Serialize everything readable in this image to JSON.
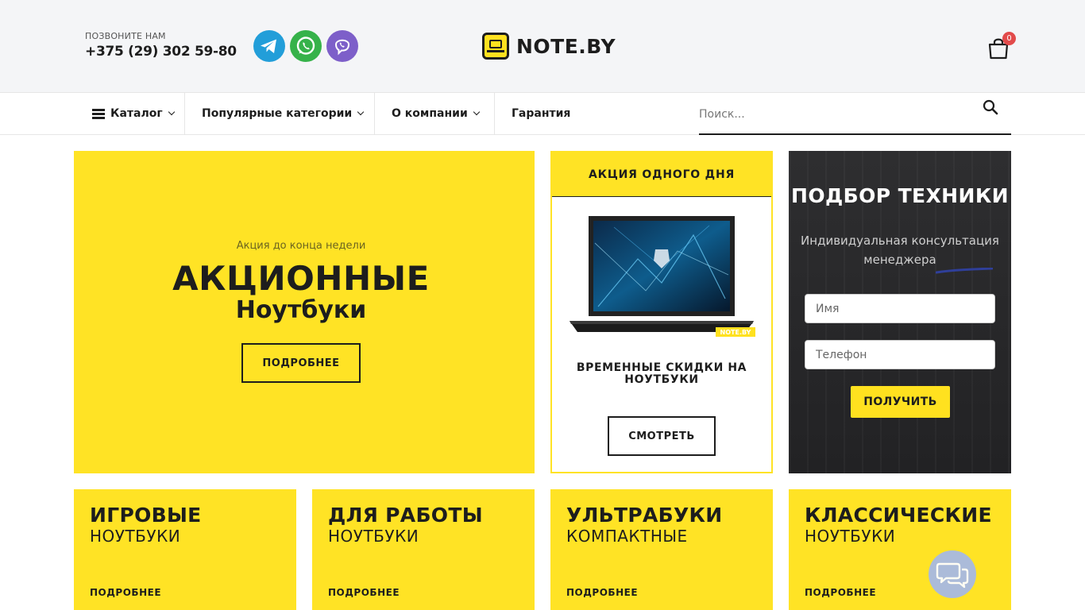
{
  "header": {
    "call_label": "ПОЗВОНИТЕ НАМ",
    "phone": "+375 (29) 302 59-80",
    "logo_text": "NOTE.BY",
    "cart_count": "0"
  },
  "nav": {
    "catalog": "Каталог",
    "popular": "Популярные категории",
    "about": "О компании",
    "warranty": "Гарантия",
    "search_placeholder": "Поиск..."
  },
  "hero": {
    "subtitle": "Акция до конца недели",
    "title": "АКЦИОННЫЕ",
    "title2": "Ноутбуки",
    "button": "ПОДРОБНЕЕ"
  },
  "deal": {
    "header": "АКЦИЯ ОДНОГО ДНЯ",
    "title": "ВРЕМЕННЫЕ СКИДКИ НА НОУТБУКИ",
    "image_badge": "NOTE.BY",
    "button": "СМОТРЕТЬ"
  },
  "pick": {
    "title": "ПОДБОР ТЕХНИКИ",
    "subtitle": "Индивидуальная консультация менеджера",
    "name_placeholder": "Имя",
    "phone_placeholder": "Телефон",
    "button": "ПОЛУЧИТЬ"
  },
  "cards": [
    {
      "title": "ИГРОВЫЕ",
      "sub": "НОУТБУКИ",
      "link": "ПОДРОБНЕЕ"
    },
    {
      "title": "ДЛЯ РАБОТЫ",
      "sub": "НОУТБУКИ",
      "link": "ПОДРОБНЕЕ"
    },
    {
      "title": "УЛЬТРАБУКИ",
      "sub": "КОМПАКТНЫЕ",
      "link": "ПОДРОБНЕЕ"
    },
    {
      "title": "КЛАССИЧЕСКИЕ",
      "sub": "НОУТБУКИ",
      "link": "ПОДРОБНЕЕ"
    }
  ],
  "colors": {
    "brand_yellow": "#ffe325",
    "dark": "#1d1d1d",
    "badge_red": "#e24b4b",
    "telegram": "#229ed9",
    "whatsapp": "#36b24a",
    "viber": "#7d5fc9"
  },
  "icons": [
    "telegram-icon",
    "whatsapp-icon",
    "viber-icon",
    "cart-icon",
    "search-icon",
    "menu-icon",
    "chat-icon"
  ]
}
